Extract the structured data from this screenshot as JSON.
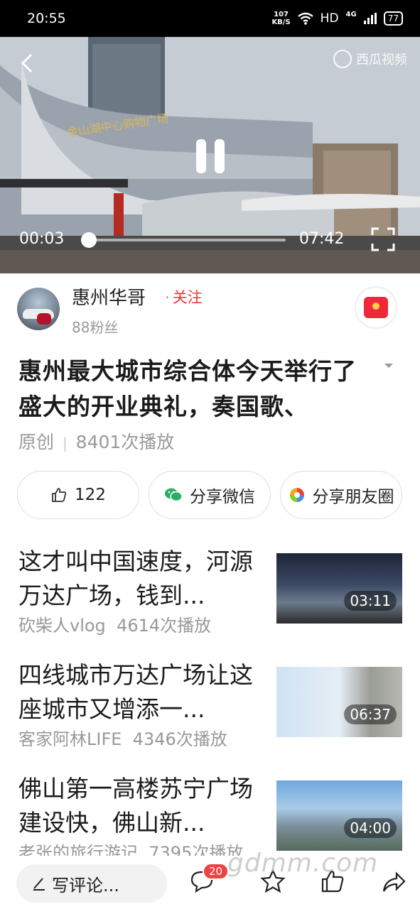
{
  "status_bar": {
    "time": "20:55",
    "net_speed_value": "107",
    "net_speed_unit": "KB/S",
    "hd": "HD",
    "signal": "4G",
    "battery": "77"
  },
  "video": {
    "brand": "西瓜视频",
    "current_time": "00:03",
    "total_time": "07:42",
    "progress_fraction": 0.0065
  },
  "author": {
    "name": "惠州华哥",
    "follow_label": "关注",
    "fans": "88粉丝"
  },
  "video_info": {
    "title": "惠州最大城市综合体今天举行了盛大的开业典礼，奏国歌、",
    "original_label": "原创",
    "plays": "8401次播放"
  },
  "actions": {
    "like_count": "122",
    "share_wechat": "分享微信",
    "share_moments": "分享朋友圈"
  },
  "related": [
    {
      "title": "这才叫中国速度，河源万达广场，钱到...",
      "author": "砍柴人vlog",
      "plays": "4614次播放",
      "duration": "03:11"
    },
    {
      "title": "四线城市万达广场让这座城市又增添一...",
      "author": "客家阿林LIFE",
      "plays": "4346次播放",
      "duration": "06:37"
    },
    {
      "title": "佛山第一高楼苏宁广场建设快，佛山新...",
      "author": "老张的旅行游记",
      "plays": "7395次播放",
      "duration": "04:00"
    }
  ],
  "bottom_bar": {
    "comment_placeholder": "写评论...",
    "comment_count": "20"
  },
  "watermark": "gdmm.com"
}
